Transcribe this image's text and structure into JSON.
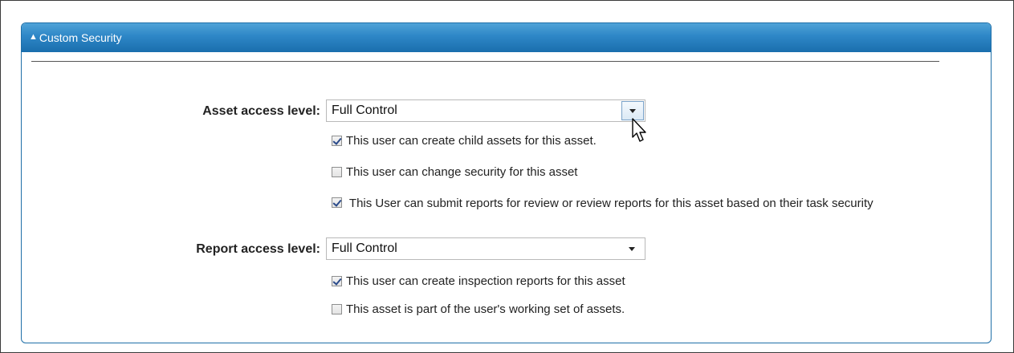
{
  "panel": {
    "toggle_glyph": "▲",
    "title": "Custom Security"
  },
  "asset_access": {
    "label": "Asset access level:",
    "selected": "Full Control"
  },
  "asset_options": [
    {
      "label": "This user can create child assets for this asset.",
      "checked": true
    },
    {
      "label": "This user can change security for this asset",
      "checked": false
    },
    {
      "label": "This User can submit reports for review or review reports for this asset based on their task security",
      "checked": true
    }
  ],
  "report_access": {
    "label": "Report access level:",
    "selected": "Full Control"
  },
  "report_options": [
    {
      "label": "This user can create inspection reports for this asset",
      "checked": true
    },
    {
      "label": "This asset is part of the user's working set of assets.",
      "checked": false
    }
  ],
  "colors": {
    "header_top": "#4fa3d8",
    "header_bottom": "#1a6ead",
    "panel_border": "#1f6fa8"
  },
  "icons": {
    "collapse": "triangle-up-icon",
    "dropdown": "chevron-down-icon",
    "cursor": "mouse-pointer-icon"
  }
}
